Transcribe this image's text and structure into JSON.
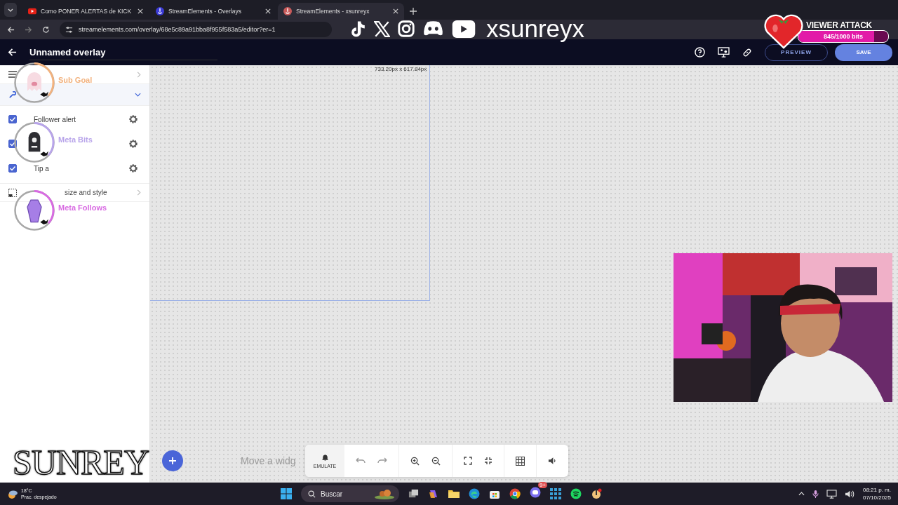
{
  "browser": {
    "tabs": [
      {
        "title": "Como PONER ALERTAS de KICK",
        "selected": false
      },
      {
        "title": "StreamElements - Overlays",
        "selected": false
      },
      {
        "title": "StreamElements - xsunreyx",
        "selected": true
      }
    ],
    "url": "streamelements.com/overlay/68e5c89a91bba8f955f583a5/editor?er=1"
  },
  "editor": {
    "title": "Unnamed overlay",
    "preview": "PREVIEW",
    "save": "SAVE"
  },
  "sidebar": {
    "alerts": [
      {
        "label": "Follower alert",
        "checked": true
      },
      {
        "checked": true
      },
      {
        "label": "Tip a",
        "checked": true
      }
    ],
    "position_label": "size and style"
  },
  "canvas": {
    "size_label": "733.20px x 617.84px",
    "hint": "Move a widg",
    "emulate": "EMULATE"
  },
  "overlay": {
    "handle": "xsunreyx",
    "viewer_attack": {
      "title": "VIEWER ATTACK",
      "progress": "845/1000 bits",
      "level": 0.845
    },
    "goals": [
      {
        "kind": "ghost",
        "title": "Sub Goal",
        "color": "#f2b27e"
      },
      {
        "kind": "tombstone",
        "title": "Meta Bits",
        "color": "#b8a4ea"
      },
      {
        "kind": "coffin",
        "title": "Meta Follows",
        "color": "#d86ae2"
      }
    ],
    "logo": "SUNREY"
  },
  "taskbar": {
    "weather": {
      "temp": "18°C",
      "desc": "Prac. despejado"
    },
    "search": "Buscar",
    "discord_badge": "9+",
    "time": "08:21 p. m.",
    "date": "07/10/2025"
  }
}
